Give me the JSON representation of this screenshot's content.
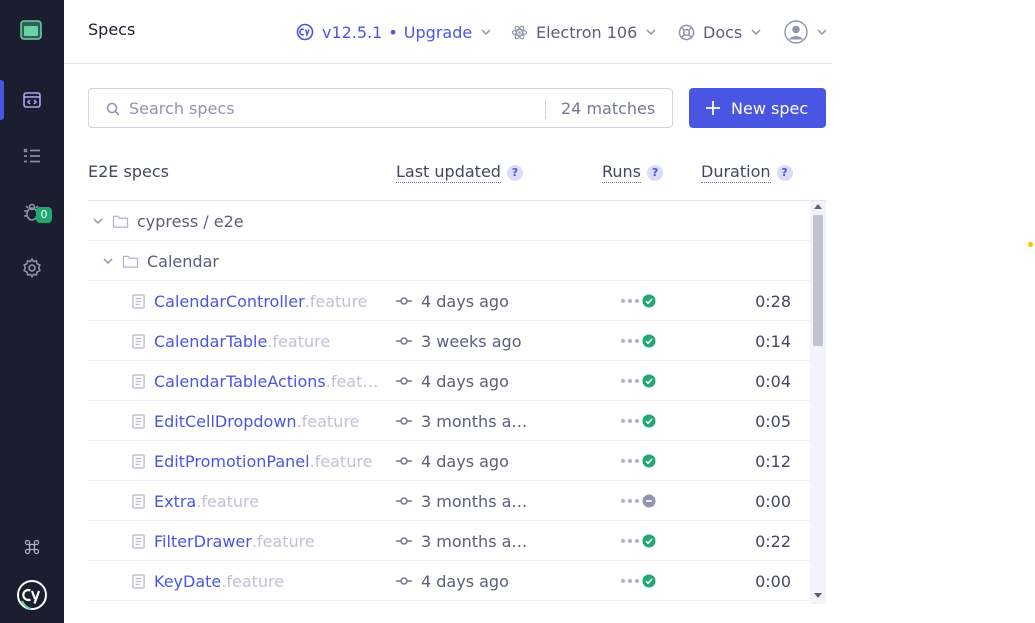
{
  "header": {
    "title": "Specs",
    "version": "v12.5.1",
    "upgrade_sep": "•",
    "upgrade": "Upgrade",
    "browser": "Electron 106",
    "docs": "Docs"
  },
  "sidebar": {
    "items": [
      {
        "icon": "specs-icon",
        "active": true
      },
      {
        "icon": "runs-list-icon",
        "active": false
      },
      {
        "icon": "debug-bug-icon",
        "badge": "0"
      },
      {
        "icon": "settings-gear-icon",
        "active": false
      }
    ],
    "bottom": [
      {
        "icon": "command-key-icon"
      },
      {
        "icon": "cypress-logo-icon"
      }
    ]
  },
  "search": {
    "placeholder": "Search specs",
    "count": "24 matches"
  },
  "new_spec_label": "New spec",
  "columns": {
    "name": "E2E specs",
    "updated": "Last updated",
    "runs": "Runs",
    "duration": "Duration",
    "help": "?"
  },
  "tree": {
    "root_folder": "cypress / e2e",
    "sub_folder": "Calendar",
    "specs": [
      {
        "name": "CalendarController",
        "ext": ".feature",
        "updated": "4 days ago",
        "status": "passed",
        "duration": "0:28"
      },
      {
        "name": "CalendarTable",
        "ext": ".feature",
        "updated": "3 weeks ago",
        "status": "passed",
        "duration": "0:14"
      },
      {
        "name": "CalendarTableActions",
        "ext": ".feat…",
        "updated": "4 days ago",
        "status": "passed",
        "duration": "0:04"
      },
      {
        "name": "EditCellDropdown",
        "ext": ".feature",
        "updated": "3 months a…",
        "status": "passed",
        "duration": "0:05"
      },
      {
        "name": "EditPromotionPanel",
        "ext": ".feature",
        "updated": "4 days ago",
        "status": "passed",
        "duration": "0:12"
      },
      {
        "name": "Extra",
        "ext": ".feature",
        "updated": "3 months a…",
        "status": "skipped",
        "duration": "0:00"
      },
      {
        "name": "FilterDrawer",
        "ext": ".feature",
        "updated": "3 months a…",
        "status": "passed",
        "duration": "0:22"
      },
      {
        "name": "KeyDate",
        "ext": ".feature",
        "updated": "4 days ago",
        "status": "passed",
        "duration": "0:00"
      }
    ]
  },
  "colors": {
    "sidebar_bg": "#1b1e2e",
    "accent": "#4956e3",
    "passed": "#1fa971",
    "skipped": "#9095ad"
  }
}
